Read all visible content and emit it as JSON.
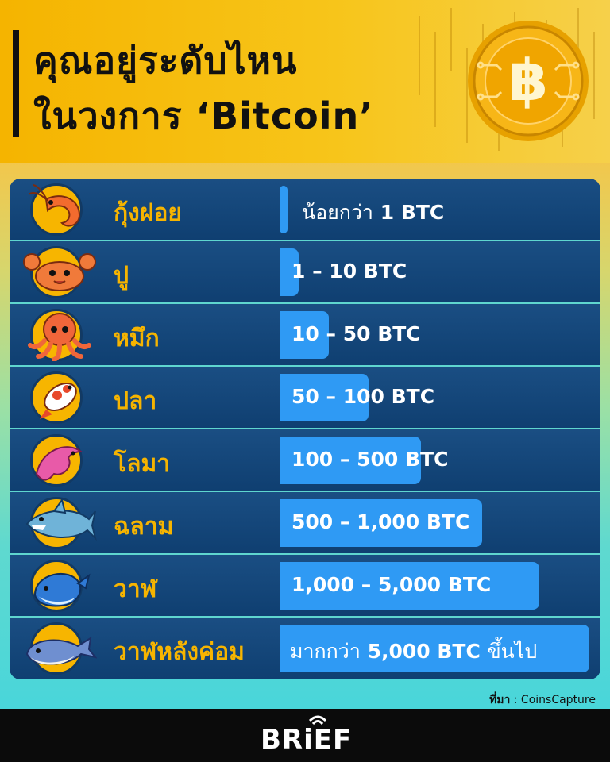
{
  "header": {
    "title_line1": "คุณอยู่ระดับไหน",
    "title_line2": "ในวงการ ‘Bitcoin’"
  },
  "levels": [
    {
      "animal_icon": "shrimp-icon",
      "name": "กุ้งฝอย",
      "range_prefix": "น้อยกว่า",
      "range": "1 BTC",
      "range_suffix": ""
    },
    {
      "animal_icon": "crab-icon",
      "name": "ปู",
      "range_prefix": "",
      "range": "1 – 10 BTC",
      "range_suffix": ""
    },
    {
      "animal_icon": "octopus-icon",
      "name": "หมึก",
      "range_prefix": "",
      "range": "10 – 50 BTC",
      "range_suffix": ""
    },
    {
      "animal_icon": "fish-icon",
      "name": "ปลา",
      "range_prefix": "",
      "range": "50 – 100 BTC",
      "range_suffix": ""
    },
    {
      "animal_icon": "dolphin-icon",
      "name": "โลมา",
      "range_prefix": "",
      "range": "100 – 500 BTC",
      "range_suffix": ""
    },
    {
      "animal_icon": "shark-icon",
      "name": "ฉลาม",
      "range_prefix": "",
      "range": "500 – 1,000 BTC",
      "range_suffix": ""
    },
    {
      "animal_icon": "whale-icon",
      "name": "วาฬ",
      "range_prefix": "",
      "range": "1,000 – 5,000 BTC",
      "range_suffix": ""
    },
    {
      "animal_icon": "humpback-whale-icon",
      "name": "วาฬหลังค่อม",
      "range_prefix": "มากกว่า",
      "range": "5,000 BTC",
      "range_suffix": "ขึ้นไป"
    }
  ],
  "source": {
    "label": "ที่มา",
    "value": ": CoinsCapture"
  },
  "footer": {
    "brand": "BRiEF"
  },
  "colors": {
    "accent_yellow": "#f6b400",
    "bar_blue": "#2f9af4",
    "table_navy": "#0f3f71"
  }
}
